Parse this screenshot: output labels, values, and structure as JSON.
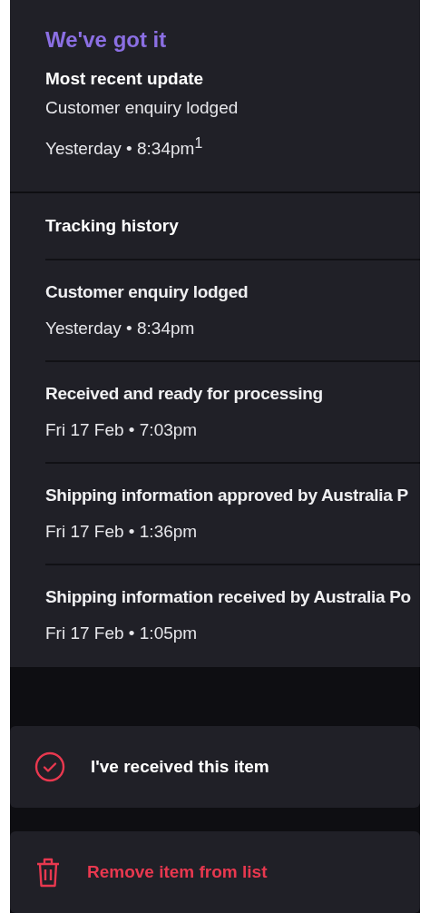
{
  "status_card": {
    "title": "We've got it",
    "heading": "Most recent update",
    "event": "Customer enquiry lodged",
    "time": "Yesterday • 8:34pm$^{1}$"
  },
  "tracking_history": {
    "title": "Tracking history",
    "events": [
      {
        "event": "Customer enquiry lodged",
        "time": "Yesterday • 8:34pm"
      },
      {
        "event": "Received and ready for processing",
        "time": "Fri 17 Feb • 7:03pm"
      },
      {
        "event": "Shipping information approved by Australia P",
        "time": "Fri 17 Feb • 1:36pm"
      },
      {
        "event": "Shipping information received by Australia Po",
        "time": "Fri 17 Feb • 1:05pm"
      }
    ]
  },
  "actions": [
    {
      "kind": "received",
      "label": "I've received this item"
    },
    {
      "kind": "remove",
      "label": "Remove item from list"
    }
  ]
}
